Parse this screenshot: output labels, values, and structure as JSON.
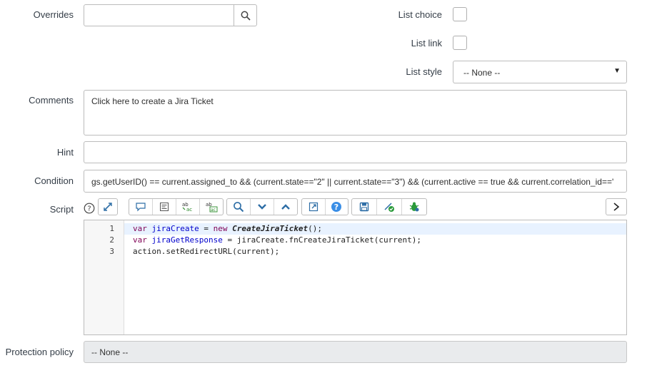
{
  "form": {
    "overrides": {
      "label": "Overrides",
      "value": ""
    },
    "list_choice": {
      "label": "List choice",
      "checked": false
    },
    "list_link": {
      "label": "List link",
      "checked": false
    },
    "list_style": {
      "label": "List style",
      "selected": "-- None --"
    },
    "comments": {
      "label": "Comments",
      "value": "Click here to create a Jira Ticket"
    },
    "hint": {
      "label": "Hint",
      "value": ""
    },
    "condition": {
      "label": "Condition",
      "value": "gs.getUserID() == current.assigned_to && (current.state==\"2\" || current.state==\"3\") && (current.active == true && current.correlation_id=='"
    },
    "script": {
      "label": "Script",
      "lines": [
        {
          "number": "1",
          "text": "var jiraCreate = new CreateJiraTicket();"
        },
        {
          "number": "2",
          "text": "var jiraGetResponse = jiraCreate.fnCreateJiraTicket(current);"
        },
        {
          "number": "3",
          "text": "action.setRedirectURL(current);"
        }
      ]
    },
    "protection_policy": {
      "label": "Protection policy",
      "value": "-- None --"
    }
  },
  "icons": {
    "search": "search-icon",
    "help": "help-icon",
    "script_assistant": "script-assistant-icon",
    "comment": "toggle-comment-icon",
    "format": "format-code-icon",
    "replace": "replace-icon",
    "replace_all": "replace-all-icon",
    "find": "find-icon",
    "find_next": "chevron-down-icon",
    "find_prev": "chevron-up-icon",
    "fullscreen": "fullscreen-icon",
    "context_help": "question-icon",
    "save": "save-icon",
    "syntax_check": "syntax-check-icon",
    "debug": "debug-icon",
    "expand": "chevron-right-icon"
  },
  "colors": {
    "accent": "#2e6ea6",
    "keyword": "#7f0055",
    "variable": "#0000cc",
    "readonly_bg": "#e9ebed"
  }
}
